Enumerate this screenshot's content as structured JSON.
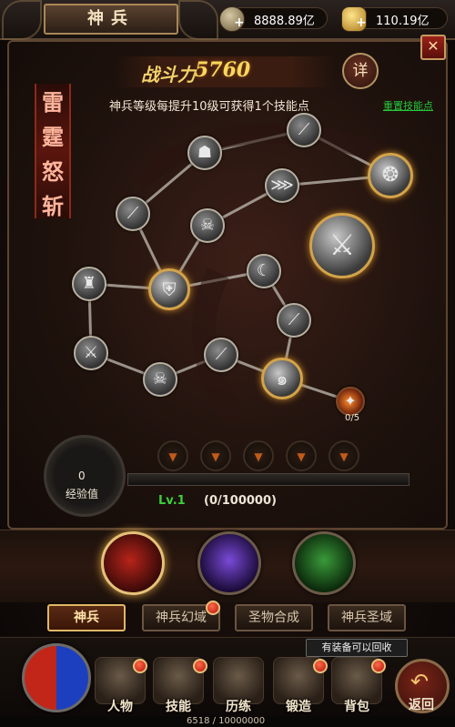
{
  "header": {
    "title": "神兵",
    "currency": [
      {
        "icon": "coin-icon",
        "value": "8888.89亿"
      },
      {
        "icon": "gold-ingot-icon",
        "value": "110.19亿"
      }
    ]
  },
  "panel": {
    "power_label": "战斗力",
    "power_value": "5760",
    "detail_button": "详",
    "info_text": "神兵等级每提升10级可获得1个技能点",
    "reset_link": "重置技能点",
    "weapon_name_chars": [
      "雷",
      "霆",
      "怒",
      "斩"
    ],
    "skill_node_count": "0/5"
  },
  "xp": {
    "value": "0",
    "label": "经验值",
    "level": "Lv.1",
    "progress": "(0/100000)",
    "fill_fraction": 0.0
  },
  "tabs": [
    {
      "label": "神兵",
      "active": true
    },
    {
      "label": "神兵幻域",
      "active": false
    },
    {
      "label": "圣物合成",
      "active": false
    },
    {
      "label": "神兵圣域",
      "active": false
    }
  ],
  "tooltip": "有装备可以回收",
  "bottom_menu": [
    {
      "label": "人物"
    },
    {
      "label": "技能"
    },
    {
      "label": "历练"
    },
    {
      "label": "锻造"
    },
    {
      "label": "背包"
    }
  ],
  "back_label": "返回",
  "bottom_exp": "6518 / 10000000",
  "colors": {
    "accent_gold": "#d3a34a",
    "reset_link_green": "#26c83a",
    "level_green": "#3ad13a",
    "alert_red": "#b3140a"
  }
}
